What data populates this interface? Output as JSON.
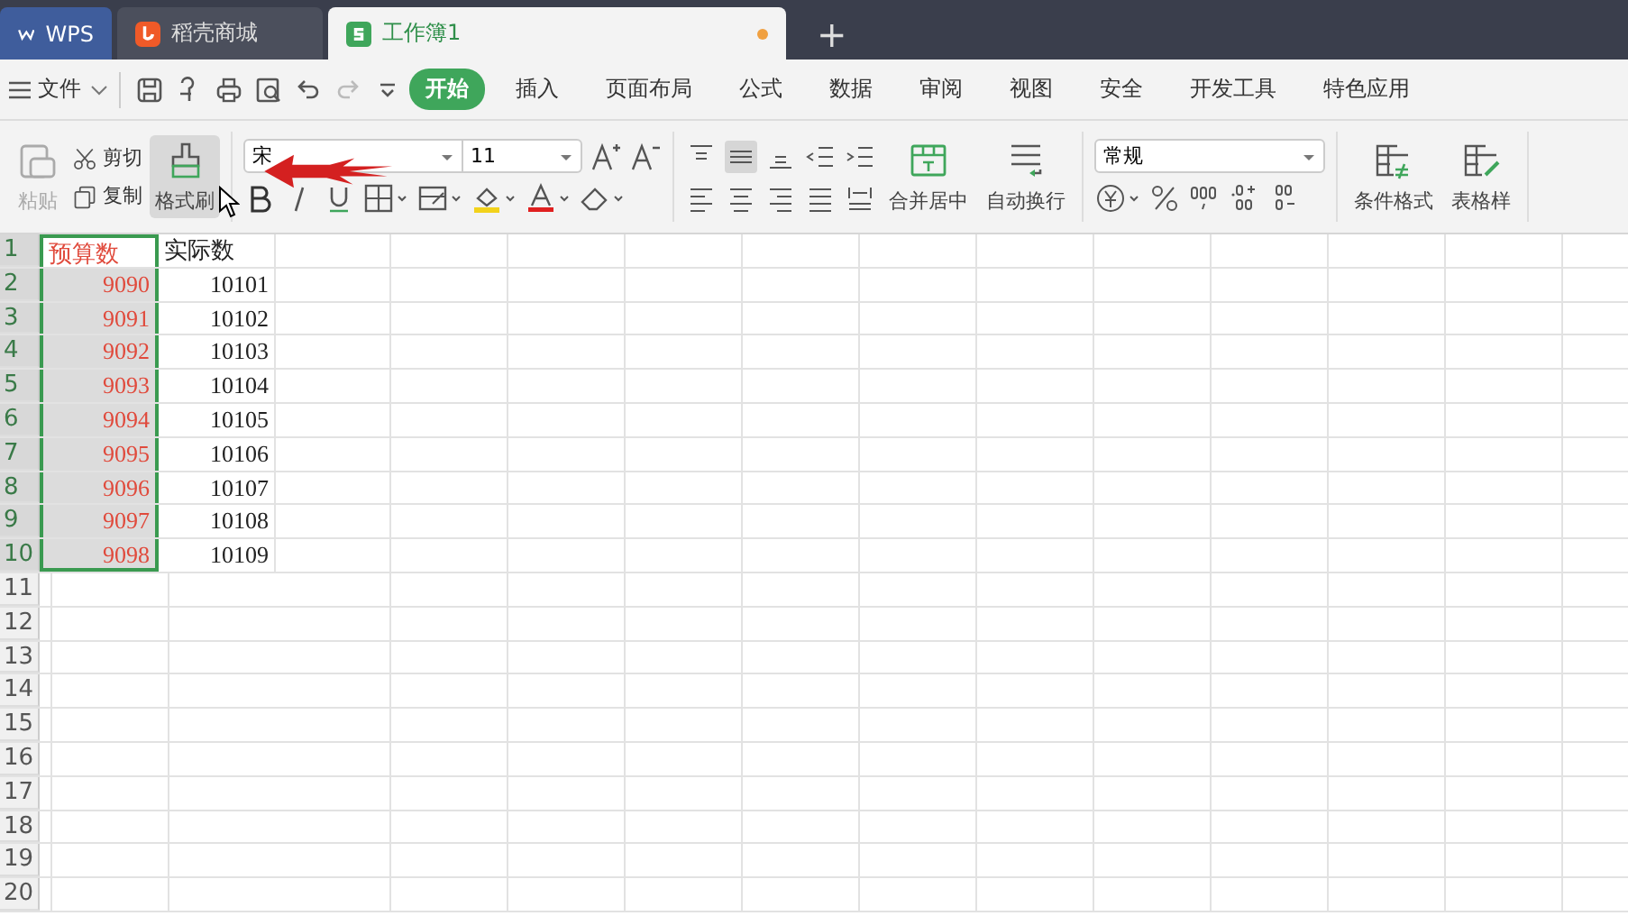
{
  "tabs": [
    {
      "label": "WPS",
      "kind": "home",
      "selected": false
    },
    {
      "label": "稻壳商城",
      "kind": "store",
      "selected": false
    },
    {
      "label": "工作簿1",
      "kind": "sheet",
      "selected": true,
      "unsaved": true
    }
  ],
  "new_tab": "+",
  "file_menu": "文件",
  "ribbon_tabs": [
    {
      "label": "开始",
      "selected": true
    },
    {
      "label": "插入",
      "selected": false
    },
    {
      "label": "页面布局",
      "selected": false
    },
    {
      "label": "公式",
      "selected": false
    },
    {
      "label": "数据",
      "selected": false
    },
    {
      "label": "审阅",
      "selected": false
    },
    {
      "label": "视图",
      "selected": false
    },
    {
      "label": "安全",
      "selected": false
    },
    {
      "label": "开发工具",
      "selected": false
    },
    {
      "label": "特色应用",
      "selected": false
    }
  ],
  "clipboard": {
    "paste": {
      "label": "粘贴",
      "disabled": true
    },
    "cut": "剪切",
    "copy": "复制",
    "format_painter": {
      "label": "格式刷",
      "active": true
    }
  },
  "font": {
    "name": "宋",
    "size": "11"
  },
  "alignment": {
    "merge": "合并居中",
    "wrap": "自动换行"
  },
  "number": {
    "format": "常规"
  },
  "styles": {
    "conditional": "条件格式",
    "table_style": "表格样"
  },
  "rows": [
    {
      "num": "1",
      "selected": true,
      "cells": [
        {
          "text": "预算数",
          "kind": "label",
          "selected": true,
          "active": true,
          "color": "#e04a3c"
        },
        {
          "text": "实际数",
          "kind": "label",
          "selected": false,
          "color": "#222222"
        }
      ]
    },
    {
      "num": "2",
      "selected": true,
      "cells": [
        {
          "text": "9090",
          "kind": "number",
          "selected": true,
          "color": "#e04a3c"
        },
        {
          "text": "10101",
          "kind": "number",
          "selected": false,
          "color": "#222222"
        }
      ]
    },
    {
      "num": "3",
      "selected": true,
      "cells": [
        {
          "text": "9091",
          "kind": "number",
          "selected": true,
          "color": "#e04a3c"
        },
        {
          "text": "10102",
          "kind": "number",
          "selected": false,
          "color": "#222222"
        }
      ]
    },
    {
      "num": "4",
      "selected": true,
      "cells": [
        {
          "text": "9092",
          "kind": "number",
          "selected": true,
          "color": "#e04a3c"
        },
        {
          "text": "10103",
          "kind": "number",
          "selected": false,
          "color": "#222222"
        }
      ]
    },
    {
      "num": "5",
      "selected": true,
      "cells": [
        {
          "text": "9093",
          "kind": "number",
          "selected": true,
          "color": "#e04a3c"
        },
        {
          "text": "10104",
          "kind": "number",
          "selected": false,
          "color": "#222222"
        }
      ]
    },
    {
      "num": "6",
      "selected": true,
      "cells": [
        {
          "text": "9094",
          "kind": "number",
          "selected": true,
          "color": "#e04a3c"
        },
        {
          "text": "10105",
          "kind": "number",
          "selected": false,
          "color": "#222222"
        }
      ]
    },
    {
      "num": "7",
      "selected": true,
      "cells": [
        {
          "text": "9095",
          "kind": "number",
          "selected": true,
          "color": "#e04a3c"
        },
        {
          "text": "10106",
          "kind": "number",
          "selected": false,
          "color": "#222222"
        }
      ]
    },
    {
      "num": "8",
      "selected": true,
      "cells": [
        {
          "text": "9096",
          "kind": "number",
          "selected": true,
          "color": "#e04a3c"
        },
        {
          "text": "10107",
          "kind": "number",
          "selected": false,
          "color": "#222222"
        }
      ]
    },
    {
      "num": "9",
      "selected": true,
      "cells": [
        {
          "text": "9097",
          "kind": "number",
          "selected": true,
          "color": "#e04a3c"
        },
        {
          "text": "10108",
          "kind": "number",
          "selected": false,
          "color": "#222222"
        }
      ]
    },
    {
      "num": "10",
      "selected": true,
      "cells": [
        {
          "text": "9098",
          "kind": "number",
          "selected": true,
          "color": "#e04a3c"
        },
        {
          "text": "10109",
          "kind": "number",
          "selected": false,
          "color": "#222222"
        }
      ]
    },
    {
      "num": "11",
      "selected": false
    },
    {
      "num": "12",
      "selected": false
    },
    {
      "num": "13",
      "selected": false
    },
    {
      "num": "14",
      "selected": false
    },
    {
      "num": "15",
      "selected": false
    },
    {
      "num": "16",
      "selected": false
    },
    {
      "num": "17",
      "selected": false
    },
    {
      "num": "18",
      "selected": false
    },
    {
      "num": "19",
      "selected": false
    },
    {
      "num": "20",
      "selected": false
    }
  ]
}
